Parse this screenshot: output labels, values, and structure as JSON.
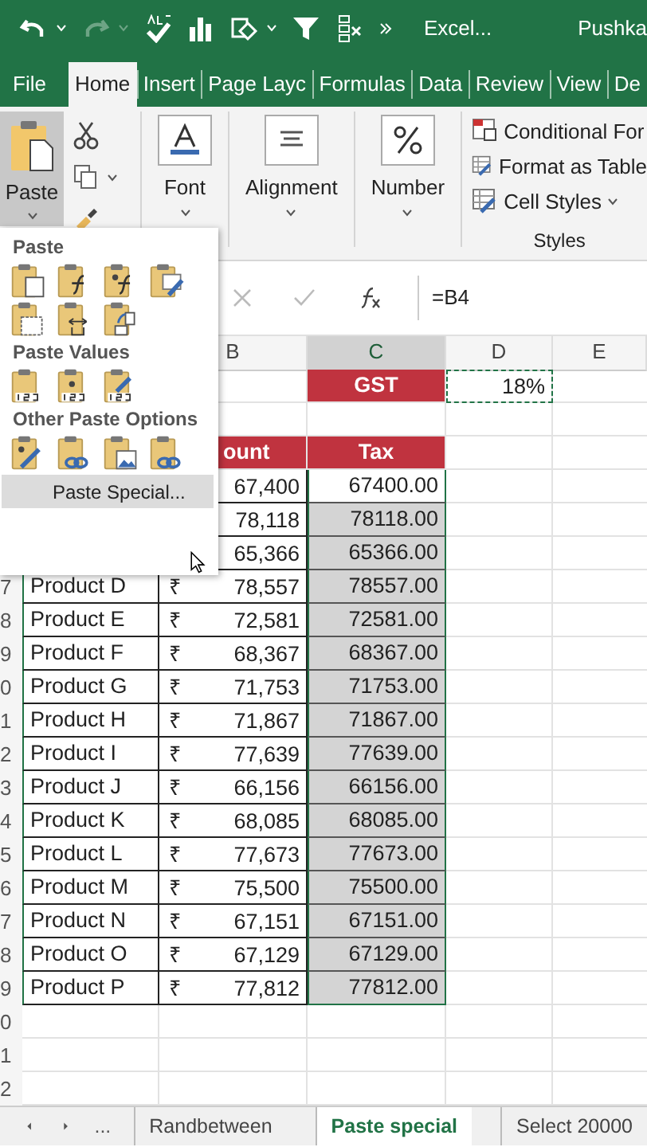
{
  "title_bar": {
    "title": "Excel...",
    "user": "Pushka"
  },
  "ribbon_tabs": [
    {
      "label": "File",
      "selected": false
    },
    {
      "label": "Home",
      "selected": true
    },
    {
      "label": "Insert",
      "selected": false
    },
    {
      "label": "Page Layc",
      "selected": false
    },
    {
      "label": "Formulas",
      "selected": false
    },
    {
      "label": "Data",
      "selected": false
    },
    {
      "label": "Review",
      "selected": false
    },
    {
      "label": "View",
      "selected": false
    },
    {
      "label": "De",
      "selected": false
    }
  ],
  "ribbon": {
    "paste": {
      "label": "Paste",
      "pressed": true
    },
    "groups": [
      {
        "label": "Font",
        "kind": "font"
      },
      {
        "label": "Alignment",
        "kind": "align"
      },
      {
        "label": "Number",
        "kind": "percent"
      }
    ],
    "styles": {
      "items": [
        {
          "label": "Conditional For",
          "dropdown": false
        },
        {
          "label": "Format as Table",
          "dropdown": false
        },
        {
          "label": "Cell Styles",
          "dropdown": true
        }
      ],
      "caption": "Styles"
    }
  },
  "formula_bar": {
    "formula": "=B4"
  },
  "columns": [
    {
      "label": "B",
      "selected": false
    },
    {
      "label": "C",
      "selected": true
    },
    {
      "label": "D",
      "selected": false
    },
    {
      "label": "E",
      "selected": false
    }
  ],
  "gst": {
    "label": "GST",
    "value": "18%"
  },
  "table_header": {
    "amount": "ount",
    "tax": "Tax"
  },
  "rows": [
    {
      "amount": "67,400",
      "tax": "67400.00",
      "shaded": false
    },
    {
      "amount": "78,118",
      "tax": "78118.00",
      "shaded": true
    },
    {
      "amount": "65,366",
      "tax": "65366.00",
      "shaded": true
    },
    {
      "number": "7",
      "product": "Product D",
      "currency": "₹",
      "amount": "78,557",
      "tax": "78557.00",
      "shaded": true
    },
    {
      "number": "8",
      "product": "Product E",
      "currency": "₹",
      "amount": "72,581",
      "tax": "72581.00",
      "shaded": true
    },
    {
      "number": "9",
      "product": "Product F",
      "currency": "₹",
      "amount": "68,367",
      "tax": "68367.00",
      "shaded": true
    },
    {
      "number": "0",
      "product": "Product G",
      "currency": "₹",
      "amount": "71,753",
      "tax": "71753.00",
      "shaded": true
    },
    {
      "number": "1",
      "product": "Product H",
      "currency": "₹",
      "amount": "71,867",
      "tax": "71867.00",
      "shaded": true
    },
    {
      "number": "2",
      "product": "Product I",
      "currency": "₹",
      "amount": "77,639",
      "tax": "77639.00",
      "shaded": true
    },
    {
      "number": "3",
      "product": "Product J",
      "currency": "₹",
      "amount": "66,156",
      "tax": "66156.00",
      "shaded": true
    },
    {
      "number": "4",
      "product": "Product K",
      "currency": "₹",
      "amount": "68,085",
      "tax": "68085.00",
      "shaded": true
    },
    {
      "number": "5",
      "product": "Product L",
      "currency": "₹",
      "amount": "77,673",
      "tax": "77673.00",
      "shaded": true
    },
    {
      "number": "6",
      "product": "Product M",
      "currency": "₹",
      "amount": "75,500",
      "tax": "75500.00",
      "shaded": true
    },
    {
      "number": "7",
      "product": "Product N",
      "currency": "₹",
      "amount": "67,151",
      "tax": "67151.00",
      "shaded": true
    },
    {
      "number": "8",
      "product": "Product O",
      "currency": "₹",
      "amount": "67,129",
      "tax": "67129.00",
      "shaded": true
    },
    {
      "number": "9",
      "product": "Product P",
      "currency": "₹",
      "amount": "77,812",
      "tax": "77812.00",
      "shaded": true
    }
  ],
  "blank_rows": [
    {
      "number": "0"
    },
    {
      "number": "1"
    },
    {
      "number": "2"
    }
  ],
  "paste_menu": {
    "sections": [
      {
        "heading": "Paste"
      },
      {
        "heading": "Paste Values"
      },
      {
        "heading": "Other Paste Options"
      }
    ],
    "item": {
      "label": "Paste Special...",
      "highlighted": true
    }
  },
  "sheet_tabs": {
    "more": "...",
    "tabs": [
      {
        "label": "Randbetween",
        "selected": false
      },
      {
        "label": "Paste special",
        "selected": true
      },
      {
        "label": "Select 20000",
        "selected": false
      }
    ]
  }
}
